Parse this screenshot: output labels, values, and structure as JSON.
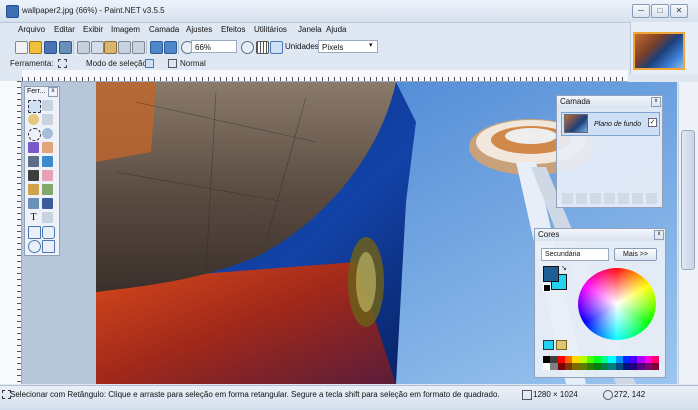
{
  "window": {
    "title": "wallpaper2.jpg (66%) - Paint.NET v3.5.5",
    "controls": {
      "minimize": "─",
      "maximize": "□",
      "close": "✕"
    }
  },
  "menu": [
    "Arquivo",
    "Editar",
    "Exibir",
    "Imagem",
    "Camada",
    "Ajustes",
    "Efeitos",
    "Utilitários",
    "Janela",
    "Ajuda"
  ],
  "toolbar": {
    "zoom_value": "66%",
    "units_label": "Unidades",
    "units_value": "Pixels"
  },
  "options_bar": {
    "tool_label": "Ferramenta:",
    "selection_mode_label": "Modo de seleção:",
    "blend_mode_value": "Normal"
  },
  "tools_panel": {
    "title": "Ferr..."
  },
  "layers_panel": {
    "title": "Camada",
    "layers": [
      {
        "name": "Plano de fundo",
        "visible": true
      }
    ]
  },
  "colors_panel": {
    "title": "Cores",
    "selected_color_target": "Secundária",
    "more_button": "Mais >>",
    "primary_color": "#1f5f96",
    "secondary_color": "#21d3ef",
    "palette": [
      "#000000",
      "#404040",
      "#ff0000",
      "#ff6a00",
      "#ffd800",
      "#b6ff00",
      "#4cff00",
      "#00ff21",
      "#00ff90",
      "#00ffff",
      "#0094ff",
      "#0026ff",
      "#4800ff",
      "#b200ff",
      "#ff00dc",
      "#ff006e",
      "#ffffff",
      "#808080",
      "#7f0000",
      "#7f3300",
      "#7f6a00",
      "#5b7f00",
      "#267f00",
      "#007f0e",
      "#007f46",
      "#007f7f",
      "#004a7f",
      "#00137f",
      "#21007f",
      "#57007f",
      "#7f006e",
      "#7f0037"
    ]
  },
  "status": {
    "hint": "Selecionar com Retângulo: Clique e arraste para seleção em forma retangular. Segure a tecla shift para seleção em formato de quadrado.",
    "image_size": "1280 × 1024",
    "cursor_position": "272, 142"
  }
}
